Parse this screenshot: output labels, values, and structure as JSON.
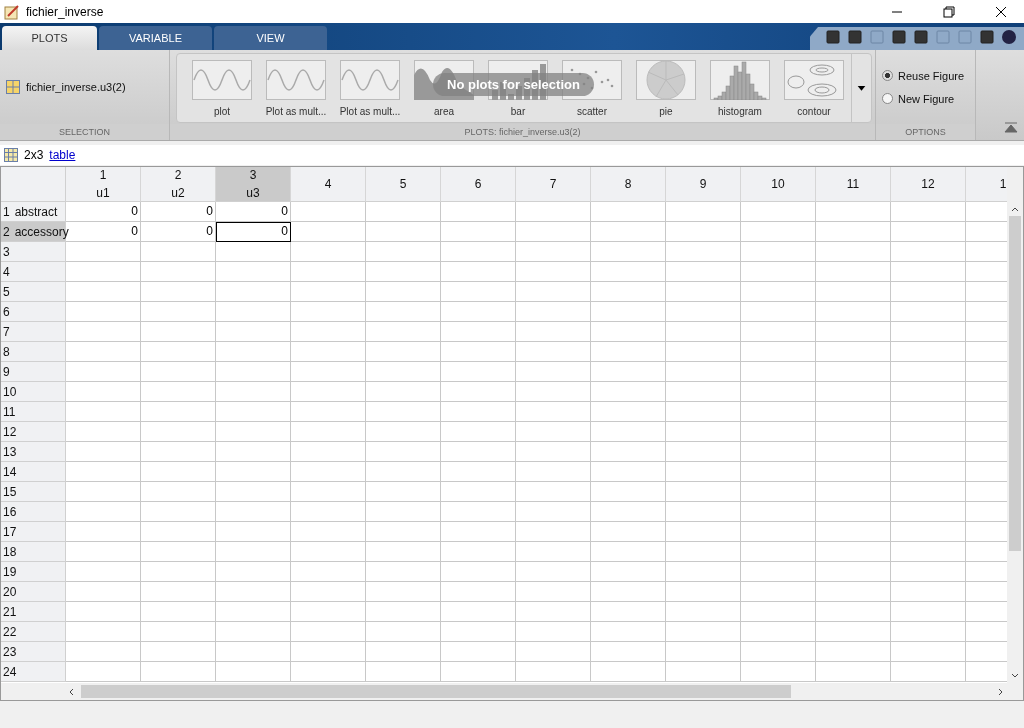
{
  "window": {
    "title": "fichier_inverse"
  },
  "tabs": [
    {
      "label": "PLOTS",
      "selected": true
    },
    {
      "label": "VARIABLE",
      "selected": false
    },
    {
      "label": "VIEW",
      "selected": false
    }
  ],
  "selection": {
    "variable": "fichier_inverse.u3(2)",
    "section_label": "SELECTION"
  },
  "plots": {
    "overlay": "No plots for selection",
    "section_label": "PLOTS: fichier_inverse.u3(2)",
    "items": [
      {
        "label": "plot",
        "kind": "sine"
      },
      {
        "label": "Plot as mult...",
        "kind": "sine"
      },
      {
        "label": "Plot as mult...",
        "kind": "sine"
      },
      {
        "label": "area",
        "kind": "area"
      },
      {
        "label": "bar",
        "kind": "bar"
      },
      {
        "label": "scatter",
        "kind": "scatter"
      },
      {
        "label": "pie",
        "kind": "pie"
      },
      {
        "label": "histogram",
        "kind": "histogram"
      },
      {
        "label": "contour",
        "kind": "contour"
      }
    ]
  },
  "options": {
    "section_label": "OPTIONS",
    "radios": [
      {
        "label": "Reuse Figure",
        "selected": true
      },
      {
        "label": "New Figure",
        "selected": false
      }
    ]
  },
  "info": {
    "size": "2x3",
    "link": "table"
  },
  "grid": {
    "columns": [
      {
        "number": "1",
        "name": "u1",
        "selected": false
      },
      {
        "number": "2",
        "name": "u2",
        "selected": false
      },
      {
        "number": "3",
        "name": "u3",
        "selected": true
      },
      {
        "number": "4",
        "selected": false
      },
      {
        "number": "5",
        "selected": false
      },
      {
        "number": "6",
        "selected": false
      },
      {
        "number": "7",
        "selected": false
      },
      {
        "number": "8",
        "selected": false
      },
      {
        "number": "9",
        "selected": false
      },
      {
        "number": "10",
        "selected": false
      },
      {
        "number": "11",
        "selected": false
      },
      {
        "number": "12",
        "selected": false
      },
      {
        "number": "1",
        "selected": false
      }
    ],
    "rows": [
      {
        "number": "1",
        "name": "abstract",
        "selected": false,
        "cells": [
          {
            "value": "0",
            "current": false
          },
          {
            "value": "0",
            "current": false
          },
          {
            "value": "0",
            "current": false
          }
        ]
      },
      {
        "number": "2",
        "name": "accessory",
        "selected": true,
        "cells": [
          {
            "value": "0",
            "current": false
          },
          {
            "value": "0",
            "current": false
          },
          {
            "value": "0",
            "current": true
          }
        ]
      },
      {
        "number": "3",
        "selected": false
      },
      {
        "number": "4",
        "selected": false
      },
      {
        "number": "5",
        "selected": false
      },
      {
        "number": "6",
        "selected": false
      },
      {
        "number": "7",
        "selected": false
      },
      {
        "number": "8",
        "selected": false
      },
      {
        "number": "9",
        "selected": false
      },
      {
        "number": "10",
        "selected": false
      },
      {
        "number": "11",
        "selected": false
      },
      {
        "number": "12",
        "selected": false
      },
      {
        "number": "13",
        "selected": false
      },
      {
        "number": "14",
        "selected": false
      },
      {
        "number": "15",
        "selected": false
      },
      {
        "number": "16",
        "selected": false
      },
      {
        "number": "17",
        "selected": false
      },
      {
        "number": "18",
        "selected": false
      },
      {
        "number": "19",
        "selected": false
      },
      {
        "number": "20",
        "selected": false
      },
      {
        "number": "21",
        "selected": false
      },
      {
        "number": "22",
        "selected": false
      },
      {
        "number": "23",
        "selected": false
      },
      {
        "number": "24",
        "selected": false
      }
    ]
  }
}
